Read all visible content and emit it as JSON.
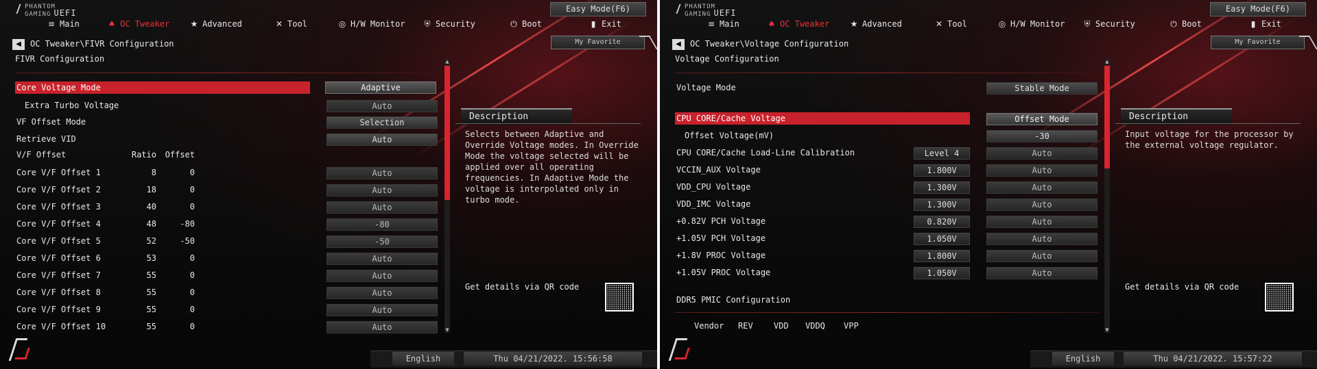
{
  "shared": {
    "logo_top": "PHANTOM",
    "logo_mid": "GAMING",
    "logo_uefi": "UEFI",
    "easy_mode": "Easy Mode(F6)",
    "my_favorite": "My Favorite",
    "nav": [
      "Main",
      "OC Tweaker",
      "Advanced",
      "Tool",
      "H/W Monitor",
      "Security",
      "Boot",
      "Exit"
    ],
    "description_title": "Description",
    "qr_text": "Get details via QR code",
    "language": "English",
    "accent": "#d9252f"
  },
  "left": {
    "breadcrumb": "OC Tweaker\\FIVR Configuration",
    "section_title": "FIVR Configuration",
    "rows": [
      {
        "label": "Core Voltage Mode",
        "value": "Adaptive"
      },
      {
        "label": "Extra Turbo Voltage",
        "value": "Auto"
      },
      {
        "label": "VF Offset Mode",
        "value": "Selection"
      },
      {
        "label": "Retrieve VID",
        "value": "Auto"
      }
    ],
    "vf_header": {
      "label": "V/F Offset",
      "ratio": "Ratio",
      "offset": "Offset"
    },
    "vf_rows": [
      {
        "label": "Core  V/F Offset  1",
        "ratio": "8",
        "offset": "0",
        "value": "Auto"
      },
      {
        "label": "Core  V/F Offset  2",
        "ratio": "18",
        "offset": "0",
        "value": "Auto"
      },
      {
        "label": "Core  V/F Offset  3",
        "ratio": "40",
        "offset": "0",
        "value": "Auto"
      },
      {
        "label": "Core  V/F Offset  4",
        "ratio": "48",
        "offset": "-80",
        "value": "-80"
      },
      {
        "label": "Core  V/F Offset  5",
        "ratio": "52",
        "offset": "-50",
        "value": "-50"
      },
      {
        "label": "Core  V/F Offset  6",
        "ratio": "53",
        "offset": "0",
        "value": "Auto"
      },
      {
        "label": "Core  V/F Offset  7",
        "ratio": "55",
        "offset": "0",
        "value": "Auto"
      },
      {
        "label": "Core  V/F Offset  8",
        "ratio": "55",
        "offset": "0",
        "value": "Auto"
      },
      {
        "label": "Core  V/F Offset  9",
        "ratio": "55",
        "offset": "0",
        "value": "Auto"
      },
      {
        "label": "Core  V/F Offset 10",
        "ratio": "55",
        "offset": "0",
        "value": "Auto"
      }
    ],
    "description": "Selects between Adaptive and\nOverride Voltage modes. In Override\nMode the voltage selected will be\napplied over all operating\nfrequencies. In Adaptive Mode the\nvoltage is interpolated only in\nturbo mode.",
    "clock": "Thu 04/21/2022. 15:56:58"
  },
  "right": {
    "breadcrumb": "OC Tweaker\\Voltage Configuration",
    "section_title": "Voltage Configuration",
    "voltage_mode": {
      "label": "Voltage Mode",
      "value": "Stable Mode"
    },
    "rows": [
      {
        "label": "CPU CORE/Cache Voltage",
        "level": "",
        "value": "Offset Mode"
      },
      {
        "label": "Offset Voltage(mV)",
        "level": "",
        "value": "-30"
      },
      {
        "label": "CPU CORE/Cache Load-Line Calibration",
        "level": "Level 4",
        "value": "Auto"
      },
      {
        "label": "VCCIN_AUX Voltage",
        "level": "1.800V",
        "value": "Auto"
      },
      {
        "label": "VDD_CPU Voltage",
        "level": "1.300V",
        "value": "Auto"
      },
      {
        "label": "VDD_IMC Voltage",
        "level": "1.300V",
        "value": "Auto"
      },
      {
        "label": "+0.82V PCH Voltage",
        "level": "0.820V",
        "value": "Auto"
      },
      {
        "label": "+1.05V PCH Voltage",
        "level": "1.050V",
        "value": "Auto"
      },
      {
        "label": "+1.8V PROC Voltage",
        "level": "1.800V",
        "value": "Auto"
      },
      {
        "label": "+1.05V PROC Voltage",
        "level": "1.050V",
        "value": "Auto"
      }
    ],
    "ddr5_title": "DDR5 PMIC Configuration",
    "ddr5_cols": [
      "Vendor",
      "REV",
      "VDD",
      "VDDQ",
      "VPP"
    ],
    "description": "Input voltage for the processor by\nthe external voltage regulator.",
    "clock": "Thu 04/21/2022. 15:57:22"
  }
}
